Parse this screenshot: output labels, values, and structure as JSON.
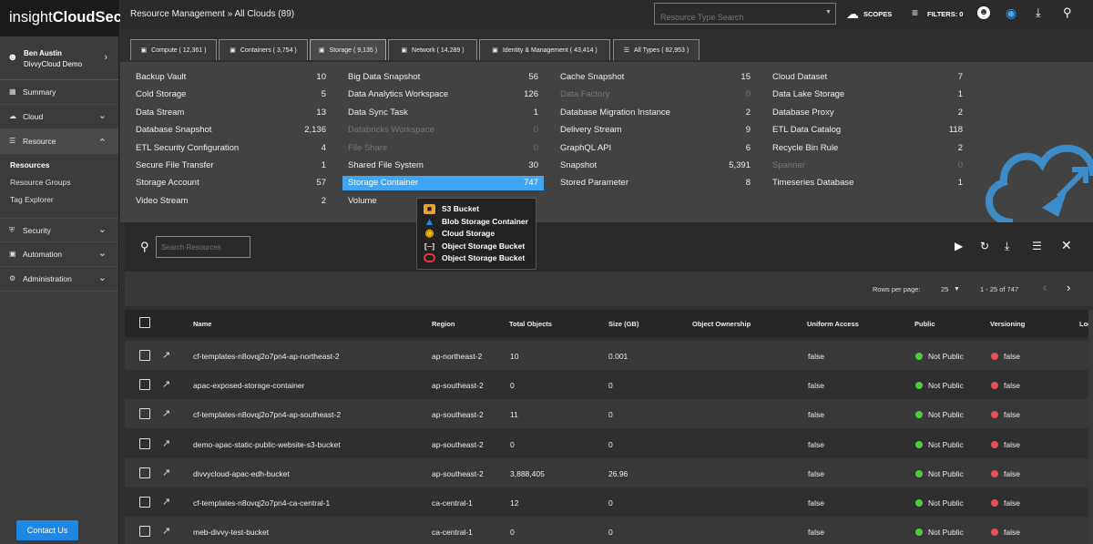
{
  "app": {
    "logo_light": "insight",
    "logo_bold": "CloudSec"
  },
  "user": {
    "name": "Ben Austin",
    "org": "DivvyCloud Demo"
  },
  "sidebar": {
    "items": [
      {
        "label": "Summary",
        "icon": "grid-icon"
      },
      {
        "label": "Cloud",
        "icon": "cloud-icon"
      },
      {
        "label": "Resource",
        "icon": "list-icon"
      },
      {
        "label": "Security",
        "icon": "shield-icon"
      },
      {
        "label": "Automation",
        "icon": "lock-icon"
      },
      {
        "label": "Administration",
        "icon": "gear-icon"
      }
    ],
    "subitems": [
      "Resources",
      "Resource Groups",
      "Tag Explorer"
    ],
    "contact_label": "Contact Us"
  },
  "topbar": {
    "breadcrumb": "Resource Management » All Clouds (89)",
    "search_placeholder": "Resource Type Search",
    "scopes_label": "SCOPES",
    "filters_label": "FILTERS: 0"
  },
  "tabs": [
    {
      "label": "Compute ( 12,361 )"
    },
    {
      "label": "Containers ( 3,754 )"
    },
    {
      "label": "Storage ( 9,135 )"
    },
    {
      "label": "Network ( 14,289 )"
    },
    {
      "label": "Identity & Management ( 43,414 )"
    },
    {
      "label": "All Types ( 82,953 )"
    }
  ],
  "resource_types": [
    [
      {
        "name": "Backup Vault",
        "count": "10"
      },
      {
        "name": "Cold Storage",
        "count": "5"
      },
      {
        "name": "Data Stream",
        "count": "13"
      },
      {
        "name": "Database Snapshot",
        "count": "2,136"
      },
      {
        "name": "ETL Security Configuration",
        "count": "4"
      },
      {
        "name": "Secure File Transfer",
        "count": "1"
      },
      {
        "name": "Storage Account",
        "count": "57"
      },
      {
        "name": "Video Stream",
        "count": "2"
      }
    ],
    [
      {
        "name": "Big Data Snapshot",
        "count": "56"
      },
      {
        "name": "Data Analytics Workspace",
        "count": "126"
      },
      {
        "name": "Data Sync Task",
        "count": "1"
      },
      {
        "name": "Databricks Workspace",
        "count": "0"
      },
      {
        "name": "File Share",
        "count": "0"
      },
      {
        "name": "Shared File System",
        "count": "30"
      },
      {
        "name": "Storage Container",
        "count": "747"
      },
      {
        "name": "Volume",
        "count": ""
      }
    ],
    [
      {
        "name": "Cache Snapshot",
        "count": "15"
      },
      {
        "name": "Data Factory",
        "count": "0"
      },
      {
        "name": "Database Migration Instance",
        "count": "2"
      },
      {
        "name": "Delivery Stream",
        "count": "9"
      },
      {
        "name": "GraphQL API",
        "count": "6"
      },
      {
        "name": "Snapshot",
        "count": "5,391"
      },
      {
        "name": "Stored Parameter",
        "count": "8"
      }
    ],
    [
      {
        "name": "Cloud Dataset",
        "count": "7"
      },
      {
        "name": "Data Lake Storage",
        "count": "1"
      },
      {
        "name": "Database Proxy",
        "count": "2"
      },
      {
        "name": "ETL Data Catalog",
        "count": "118"
      },
      {
        "name": "Recycle Bin Rule",
        "count": "2"
      },
      {
        "name": "Spanner",
        "count": "0"
      },
      {
        "name": "Timeseries Database",
        "count": "1"
      }
    ]
  ],
  "tooltip": [
    {
      "label": "S3 Bucket",
      "icon": "aws-icon",
      "color": "#e7a23a"
    },
    {
      "label": "Blob Storage Container",
      "icon": "azure-icon",
      "color": "#1e88e5"
    },
    {
      "label": "Cloud Storage",
      "icon": "gcp-icon",
      "color": "#fbbc05"
    },
    {
      "label": "Object Storage Bucket",
      "icon": "alibaba-icon",
      "color": "#ffffff"
    },
    {
      "label": "Object Storage Bucket",
      "icon": "oracle-icon",
      "color": "#e53935"
    }
  ],
  "search": {
    "placeholder": "Search Resources"
  },
  "pagination": {
    "rows_label": "Rows per page:",
    "rows_value": "25",
    "range": "1 - 25 of 747"
  },
  "table": {
    "headers": [
      "Name",
      "Region",
      "Total Objects",
      "Size (GB)",
      "Object Ownership",
      "Uniform Access",
      "Public",
      "Versioning",
      "Log"
    ],
    "rows": [
      {
        "name": "cf-templates-n8ovqj2o7pn4-ap-northeast-2",
        "region": "ap-northeast-2",
        "objects": "10",
        "size": "0.001",
        "ownership": "",
        "uniform": "false",
        "public": "Not Public",
        "versioning": "false"
      },
      {
        "name": "apac-exposed-storage-container",
        "region": "ap-southeast-2",
        "objects": "0",
        "size": "0",
        "ownership": "",
        "uniform": "false",
        "public": "Not Public",
        "versioning": "false"
      },
      {
        "name": "cf-templates-n8ovqj2o7pn4-ap-southeast-2",
        "region": "ap-southeast-2",
        "objects": "11",
        "size": "0",
        "ownership": "",
        "uniform": "false",
        "public": "Not Public",
        "versioning": "false"
      },
      {
        "name": "demo-apac-static-public-website-s3-bucket",
        "region": "ap-southeast-2",
        "objects": "0",
        "size": "0",
        "ownership": "",
        "uniform": "false",
        "public": "Not Public",
        "versioning": "false"
      },
      {
        "name": "divvycloud-apac-edh-bucket",
        "region": "ap-southeast-2",
        "objects": "3,888,405",
        "size": "26.96",
        "ownership": "",
        "uniform": "false",
        "public": "Not Public",
        "versioning": "false"
      },
      {
        "name": "cf-templates-n8ovqj2o7pn4-ca-central-1",
        "region": "ca-central-1",
        "objects": "12",
        "size": "0",
        "ownership": "",
        "uniform": "false",
        "public": "Not Public",
        "versioning": "false"
      },
      {
        "name": "meb-divvy-test-bucket",
        "region": "ca-central-1",
        "objects": "0",
        "size": "0",
        "ownership": "",
        "uniform": "false",
        "public": "Not Public",
        "versioning": "false"
      }
    ]
  },
  "colors": {
    "accent": "#41a5f5",
    "public_ok": "#4cce3a",
    "versioning_off": "#e35252",
    "contact_button": "#1e88e5"
  }
}
